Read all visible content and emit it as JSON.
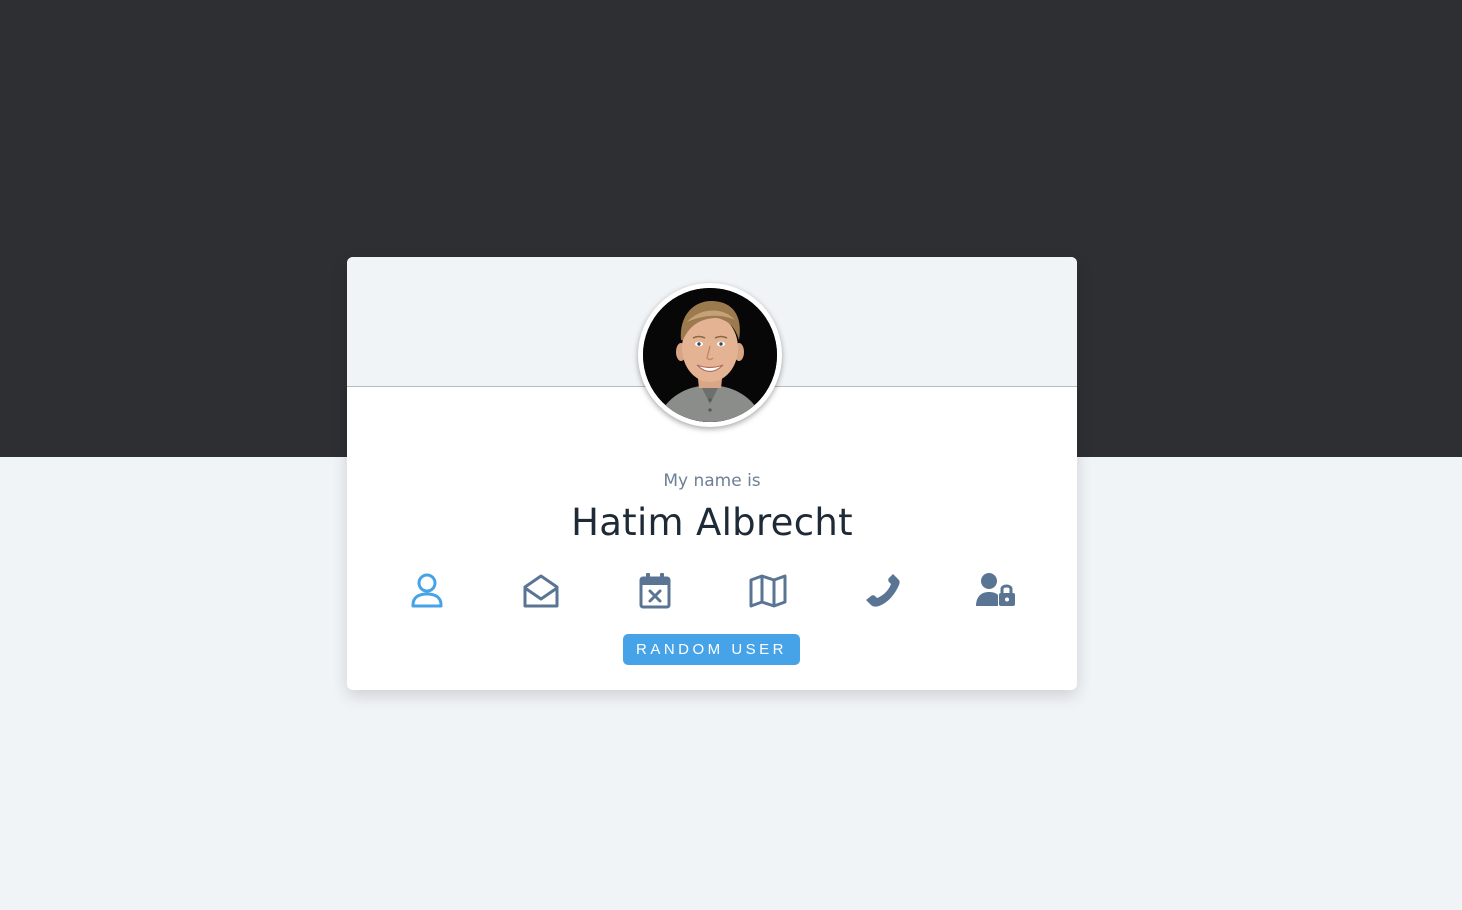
{
  "card": {
    "label": "My name is",
    "value": "Hatim Albrecht",
    "icons": [
      {
        "name": "user-icon",
        "active": true
      },
      {
        "name": "envelope-open-icon",
        "active": false
      },
      {
        "name": "calendar-x-icon",
        "active": false
      },
      {
        "name": "map-icon",
        "active": false
      },
      {
        "name": "phone-icon",
        "active": false
      },
      {
        "name": "user-lock-icon",
        "active": false
      }
    ],
    "button_label": "RANDOM USER"
  },
  "colors": {
    "dark_band": "#2e2f33",
    "page_bg": "#f0f4f7",
    "accent": "#46a3e8",
    "icon_default": "#5a7594",
    "label_text": "#6e7f96",
    "value_text": "#1f2a37"
  }
}
